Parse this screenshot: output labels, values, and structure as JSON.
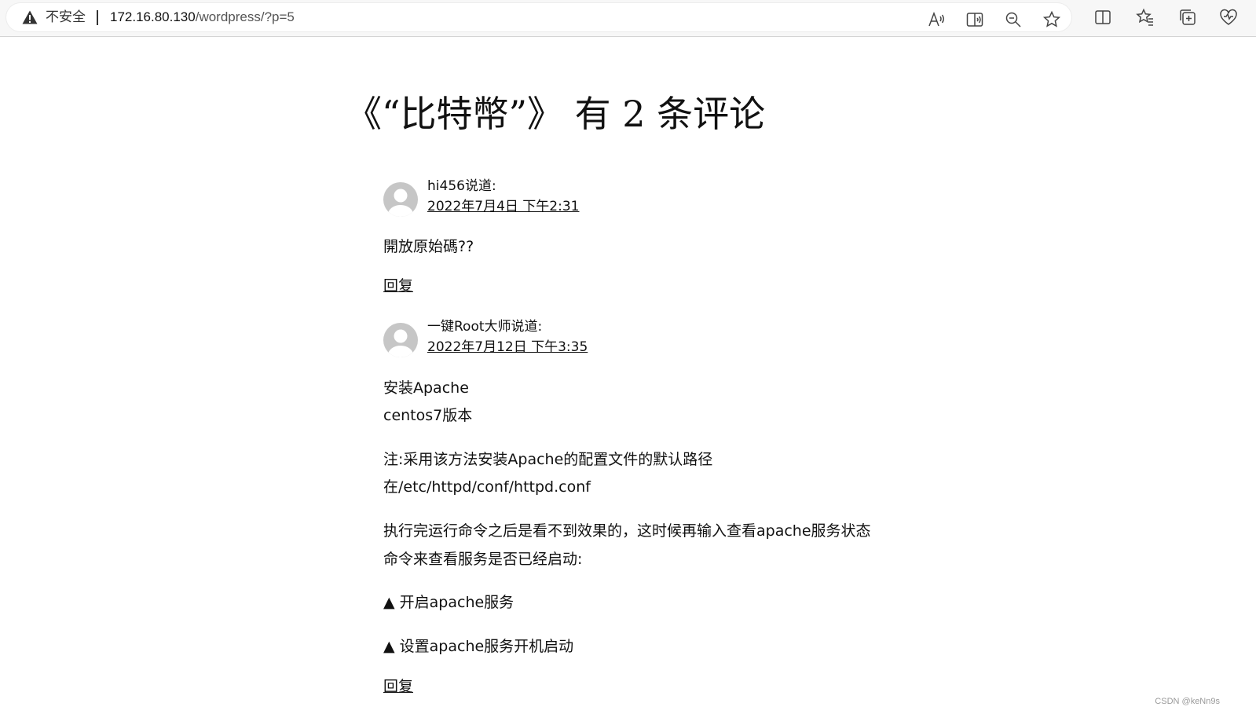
{
  "browser": {
    "security_label": "不安全",
    "url_host": "172.16.80.130",
    "url_path": "/wordpress/?p=5",
    "toolbar_icons": [
      "read-aloud-icon",
      "immersive-reader-icon",
      "zoom-out-icon",
      "favorite-star-icon",
      "split-screen-icon",
      "favorites-icon",
      "collections-icon",
      "browser-essentials-icon"
    ]
  },
  "page": {
    "heading": "《“比特幣”》 有 2 条评论"
  },
  "comments": [
    {
      "author": "hi456说道:",
      "date": "2022年7月4日 下午2:31",
      "lines": [
        "開放原始碼??"
      ],
      "reply": "回复"
    },
    {
      "author": "一键Root大师说道:",
      "date": "2022年7月12日 下午3:35",
      "lines": [
        "安装Apache",
        "centos7版本",
        "注:采用该方法安装Apache的配置文件的默认路径",
        "在/etc/httpd/conf/httpd.conf",
        "执行完运行命令之后是看不到效果的，这时候再输入查看apache服务状态",
        "命令来查看服务是否已经启动:",
        "▲ 开启apache服务",
        "▲ 设置apache服务开机启动"
      ],
      "reply": "回复"
    }
  ],
  "watermark": "CSDN @keNn9s"
}
